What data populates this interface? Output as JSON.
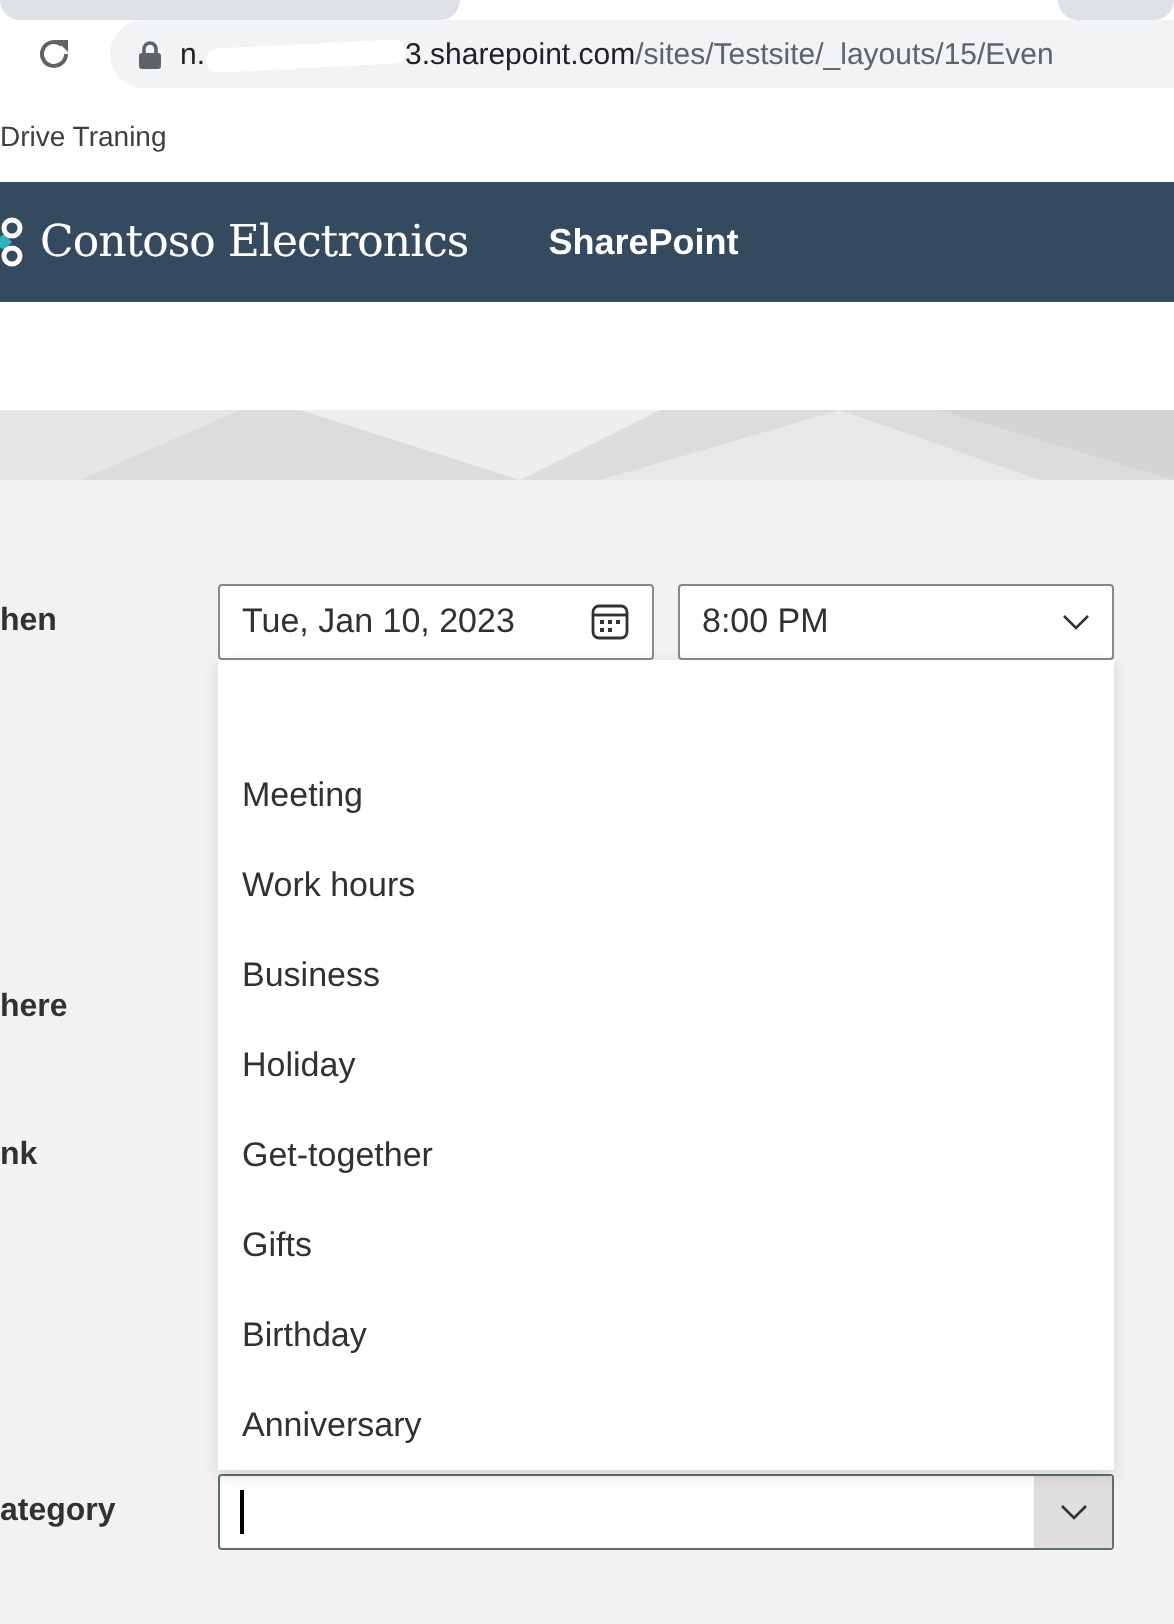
{
  "browser": {
    "url_start": "n.",
    "url_host": "3.sharepoint.com",
    "url_path": "/sites/Testsite/_layouts/15/Even",
    "bookmark": "Drive Traning"
  },
  "header": {
    "brand": "Contoso Electronics",
    "app": "SharePoint"
  },
  "when": {
    "label": "hen",
    "start_date": "Tue, Jan 10, 2023",
    "start_time": "8:00 PM"
  },
  "where": {
    "label": "here"
  },
  "link": {
    "label": "nk"
  },
  "category": {
    "label": "ategory",
    "options": [
      {
        "label": "Meeting",
        "selected": false
      },
      {
        "label": "Work hours",
        "selected": false
      },
      {
        "label": "Business",
        "selected": false
      },
      {
        "label": "Holiday",
        "selected": false
      },
      {
        "label": "Get-together",
        "selected": false
      },
      {
        "label": "Gifts",
        "selected": false
      },
      {
        "label": "Birthday",
        "selected": false
      },
      {
        "label": "Anniversary",
        "selected": false
      }
    ]
  }
}
